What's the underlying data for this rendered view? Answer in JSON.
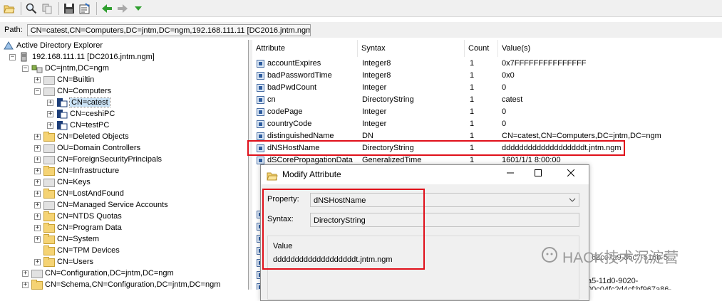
{
  "toolbar": {
    "buttons": [
      {
        "name": "open-icon"
      },
      {
        "name": "search-icon"
      },
      {
        "name": "compare-icon"
      },
      {
        "name": "save-icon"
      },
      {
        "name": "properties-icon"
      },
      {
        "name": "back-arrow-icon"
      },
      {
        "name": "forward-arrow-icon"
      },
      {
        "name": "dropdown-arrow-icon"
      }
    ]
  },
  "path": {
    "label": "Path:",
    "value": "CN=catest,CN=Computers,DC=jntm,DC=ngm,192.168.111.11 [DC2016.jntm.ngm]"
  },
  "tree": {
    "root": "Active Directory Explorer",
    "server": "192.168.111.11 [DC2016.jntm.ngm]",
    "domain": "DC=jntm,DC=ngm",
    "builtin": "CN=Builtin",
    "computers": "CN=Computers",
    "catest": "CN=catest",
    "ceshipc": "CN=ceshiPC",
    "testpc": "CN=testPC",
    "deleted": "CN=Deleted Objects",
    "domain_controllers": "OU=Domain Controllers",
    "foreign": "CN=ForeignSecurityPrincipals",
    "infrastructure": "CN=Infrastructure",
    "keys": "CN=Keys",
    "lostfound": "CN=LostAndFound",
    "managed": "CN=Managed Service Accounts",
    "ntds": "CN=NTDS Quotas",
    "program_data": "CN=Program Data",
    "system": "CN=System",
    "tpm": "CN=TPM Devices",
    "users": "CN=Users",
    "configuration": "CN=Configuration,DC=jntm,DC=ngm",
    "schema": "CN=Schema,CN=Configuration,DC=jntm,DC=ngm"
  },
  "attributes": {
    "headers": {
      "attribute": "Attribute",
      "syntax": "Syntax",
      "count": "Count",
      "values": "Value(s)"
    },
    "rows": [
      {
        "attribute": "accountExpires",
        "syntax": "Integer8",
        "count": "1",
        "value": "0x7FFFFFFFFFFFFFFF"
      },
      {
        "attribute": "badPasswordTime",
        "syntax": "Integer8",
        "count": "1",
        "value": "0x0"
      },
      {
        "attribute": "badPwdCount",
        "syntax": "Integer",
        "count": "1",
        "value": "0"
      },
      {
        "attribute": "cn",
        "syntax": "DirectoryString",
        "count": "1",
        "value": "catest"
      },
      {
        "attribute": "codePage",
        "syntax": "Integer",
        "count": "1",
        "value": "0"
      },
      {
        "attribute": "countryCode",
        "syntax": "Integer",
        "count": "1",
        "value": "0"
      },
      {
        "attribute": "distinguishedName",
        "syntax": "DN",
        "count": "1",
        "value": "CN=catest,CN=Computers,DC=jntm,DC=ngm"
      },
      {
        "attribute": "dNSHostName",
        "syntax": "DirectoryString",
        "count": "1",
        "value": "dddddddddddddddddddt.jntm.ngm"
      },
      {
        "attribute": "dSCorePropagationData",
        "syntax": "GeneralizedTime",
        "count": "1",
        "value": "1601/1/1 8:00:00"
      }
    ],
    "partial_right_1": "62cc7a9-35c7-516b-5...",
    "partial_right_2": "a5-11d0-9020-00c04fc2d4cf;bf967a86-"
  },
  "dialog": {
    "title": "Modify Attribute",
    "property_label": "Property:",
    "property_value": "dNSHostName",
    "syntax_label": "Syntax:",
    "syntax_value": "DirectoryString",
    "value_label": "Value",
    "value_text": "dddddddddddddddddddt.jntm.ngm"
  },
  "watermark": {
    "text": "HACK技术沉淀营"
  },
  "colors": {
    "highlight": "#e0101a",
    "selection": "#cce4f7"
  }
}
